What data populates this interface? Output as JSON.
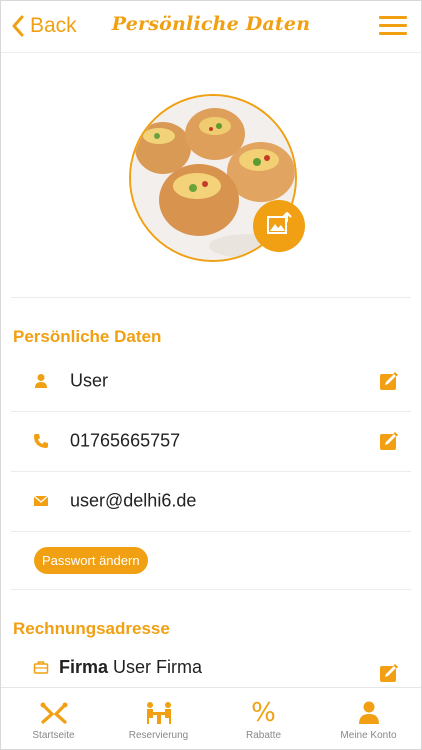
{
  "header": {
    "back_label": "Back",
    "title": "Persönliche Daten"
  },
  "colors": {
    "accent": "#f0a012",
    "divider": "#ececec",
    "text": "#222222",
    "tab_label": "#888888"
  },
  "icons": {
    "back": "chevron-left-icon",
    "menu": "hamburger-menu-icon",
    "photo_change": "image-upload-icon",
    "user": "person-icon",
    "phone": "phone-icon",
    "email": "envelope-icon",
    "edit": "edit-pencil-icon",
    "company": "briefcase-icon"
  },
  "personal": {
    "section_title": "Persönliche Daten",
    "name": "User",
    "phone": "01765665757",
    "email": "user@delhi6.de",
    "password_button": "Passwort ändern"
  },
  "billing": {
    "section_title": "Rechnungsadresse",
    "company_label": "Firma",
    "company_value": "User Firma"
  },
  "tabbar": {
    "items": [
      {
        "label": "Startseite",
        "icon": "home-cutlery-icon"
      },
      {
        "label": "Reservierung",
        "icon": "table-reservation-icon"
      },
      {
        "label": "Rabatte",
        "icon": "percent-icon",
        "glyph": "%"
      },
      {
        "label": "Meine Konto",
        "icon": "account-person-icon"
      }
    ]
  }
}
